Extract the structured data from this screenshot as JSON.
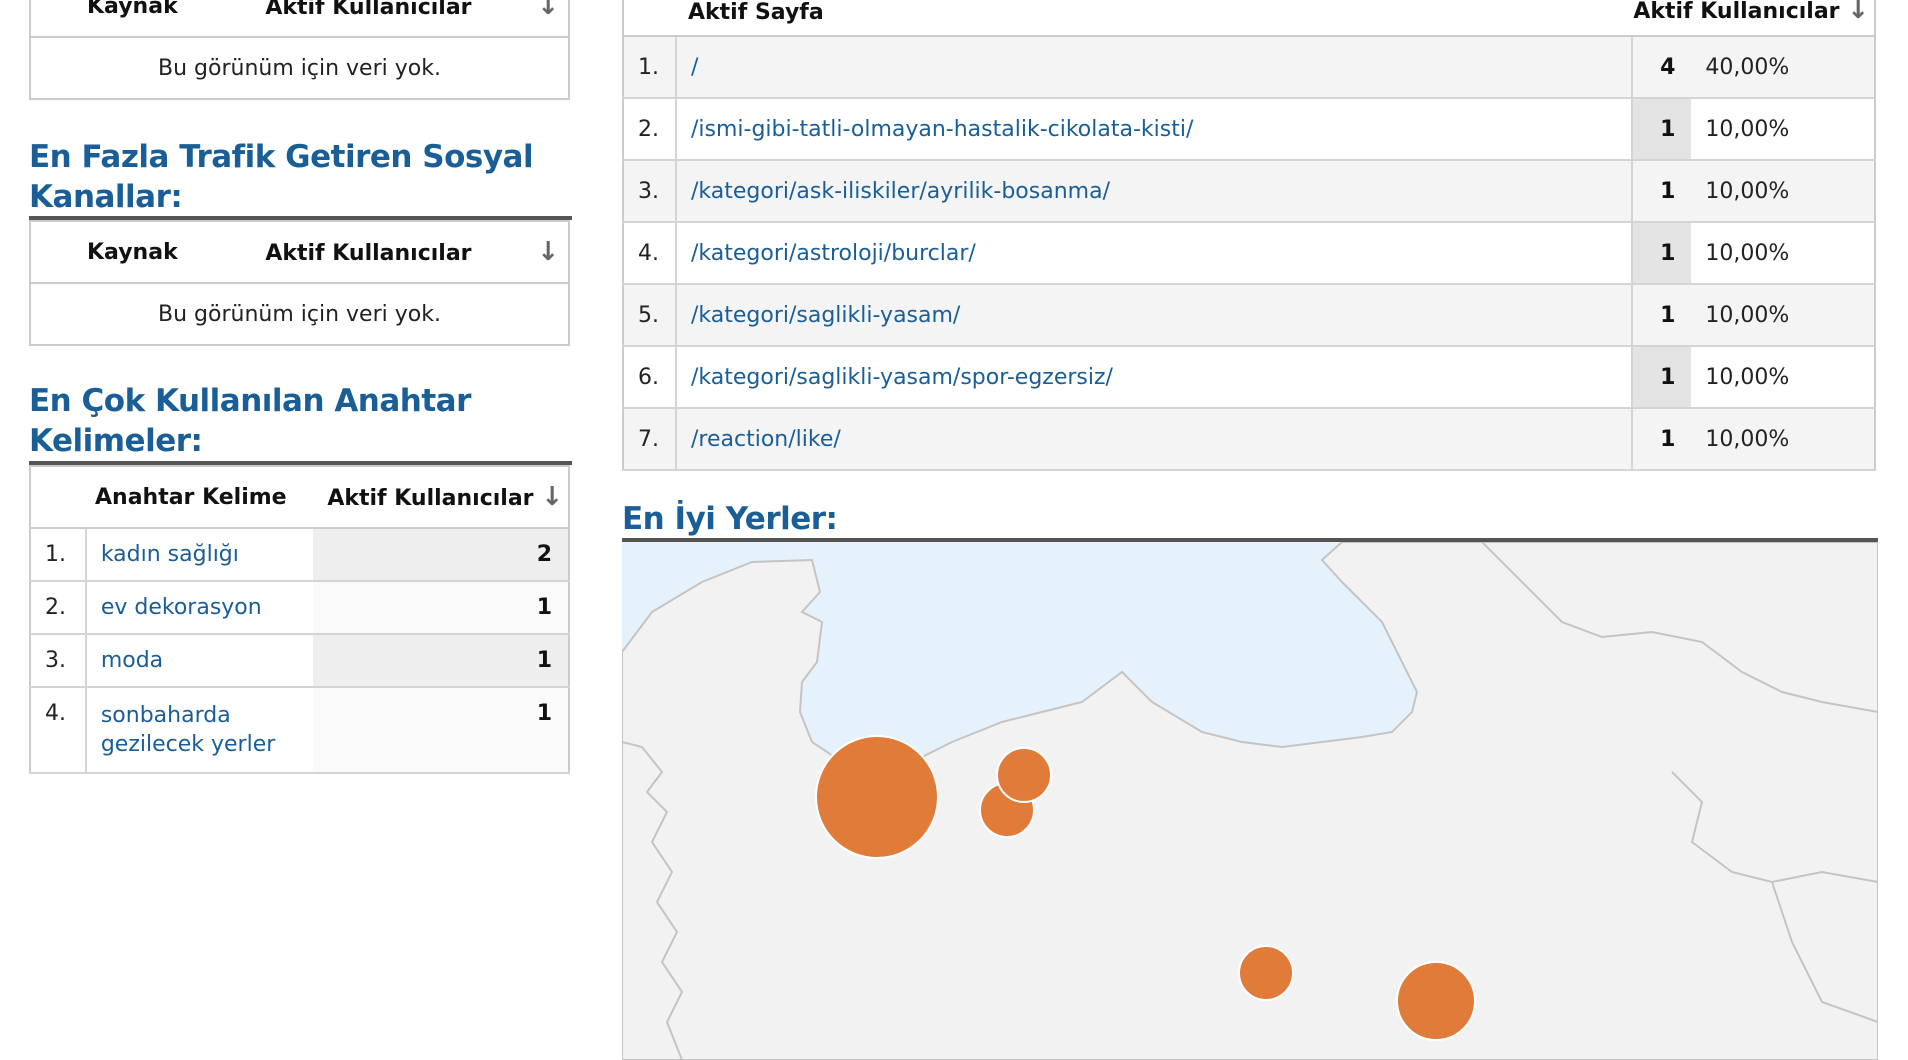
{
  "referral_table": {
    "col_source": "Kaynak",
    "col_users": "Aktif Kullanıcılar",
    "sort_icon": "↓",
    "empty_text": "Bu görünüm için veri yok."
  },
  "social": {
    "title": "En Fazla Trafik Getiren Sosyal Kanallar:",
    "col_source": "Kaynak",
    "col_users": "Aktif Kullanıcılar",
    "sort_icon": "↓",
    "empty_text": "Bu görünüm için veri yok."
  },
  "keywords": {
    "title": "En Çok Kullanılan Anahtar Kelimeler:",
    "col_keyword": "Anahtar Kelime",
    "col_users": "Aktif Kullanıcılar",
    "sort_icon": "↓",
    "rows": [
      {
        "num": "1.",
        "label": "kadın sağlığı",
        "count": "2"
      },
      {
        "num": "2.",
        "label": "ev dekorasyon",
        "count": "1"
      },
      {
        "num": "3.",
        "label": "moda",
        "count": "1"
      },
      {
        "num": "4.",
        "label": "sonbaharda gezilecek yerler",
        "count": "1"
      }
    ]
  },
  "pages": {
    "col_page": "Aktif Sayfa",
    "col_users": "Aktif Kullanıcılar",
    "sort_icon": "↓",
    "rows": [
      {
        "num": "1.",
        "path": "/",
        "count": "4",
        "percent": "40,00%"
      },
      {
        "num": "2.",
        "path": "/ismi-gibi-tatli-olmayan-hastalik-cikolata-kisti/",
        "count": "1",
        "percent": "10,00%"
      },
      {
        "num": "3.",
        "path": "/kategori/ask-iliskiler/ayrilik-bosanma/",
        "count": "1",
        "percent": "10,00%"
      },
      {
        "num": "4.",
        "path": "/kategori/astroloji/burclar/",
        "count": "1",
        "percent": "10,00%"
      },
      {
        "num": "5.",
        "path": "/kategori/saglikli-yasam/",
        "count": "1",
        "percent": "10,00%"
      },
      {
        "num": "6.",
        "path": "/kategori/saglikli-yasam/spor-egzersiz/",
        "count": "1",
        "percent": "10,00%"
      },
      {
        "num": "7.",
        "path": "/reaction/like/",
        "count": "1",
        "percent": "10,00%"
      }
    ]
  },
  "locations": {
    "title": "En İyi Yerler:",
    "colors": {
      "sea": "#e6f2fb",
      "land": "#f2f2f2",
      "border": "#c4c4c4",
      "bubble": "#e07b39",
      "bubble_stroke": "#ffffff"
    }
  }
}
